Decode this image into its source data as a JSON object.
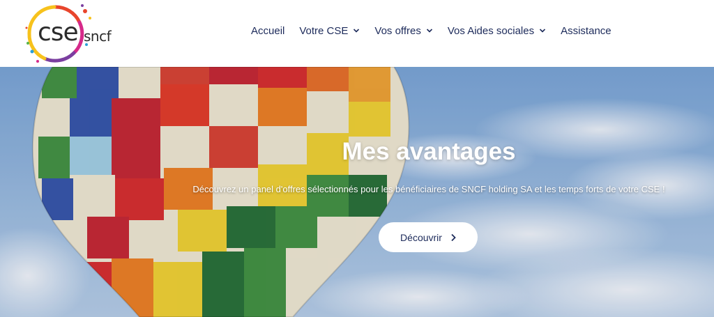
{
  "header": {
    "logo": {
      "text_main": "cse",
      "text_secondary": "sncf",
      "ring_colors": [
        "#f7c21c",
        "#e8452c",
        "#d62a8a",
        "#7b3fa0",
        "#2a9fd8",
        "#5bb54a"
      ]
    },
    "nav": [
      {
        "label": "Accueil",
        "has_dropdown": false
      },
      {
        "label": "Votre CSE",
        "has_dropdown": true
      },
      {
        "label": "Vos offres",
        "has_dropdown": true
      },
      {
        "label": "Vos Aides sociales",
        "has_dropdown": true
      },
      {
        "label": "Assistance",
        "has_dropdown": false
      }
    ]
  },
  "hero": {
    "title": "Mes avantages",
    "subtitle": "Découvrez un panel d'offres sélectionnés pour les bénéficiaires de SNCF holding SA et les temps forts de votre CSE !",
    "button_label": "Découvrir",
    "button_icon": "chevron-right-icon"
  },
  "colors": {
    "nav_text": "#1c2a5a",
    "sky": "#8fb4dc"
  }
}
